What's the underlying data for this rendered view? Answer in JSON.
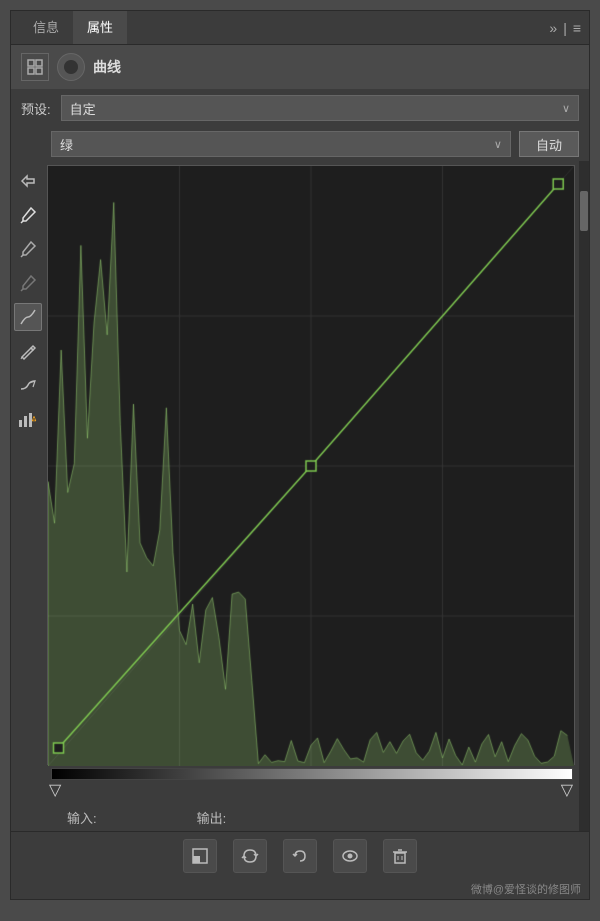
{
  "tabs": [
    {
      "label": "信息",
      "active": false
    },
    {
      "label": "属性",
      "active": true
    }
  ],
  "tab_icons": {
    "double_arrow": "»",
    "divider": "|",
    "menu": "≡"
  },
  "panel_title": "曲线",
  "preset": {
    "label": "预设:",
    "value": "自定",
    "arrow": "∨"
  },
  "channel": {
    "value": "绿",
    "arrow": "∨"
  },
  "auto_btn": "自动",
  "tools": [
    {
      "name": "eyedropper-white",
      "icon": "⁍"
    },
    {
      "name": "eyedropper-gray",
      "icon": "⁌"
    },
    {
      "name": "eyedropper-black",
      "icon": "⁍"
    },
    {
      "name": "curve-tool",
      "icon": "∿",
      "active": true
    },
    {
      "name": "pencil-tool",
      "icon": "✏"
    },
    {
      "name": "arrow-back",
      "icon": "↩"
    },
    {
      "name": "histogram-warning",
      "icon": "▦"
    }
  ],
  "io": {
    "input_label": "输入:",
    "output_label": "输出:",
    "input_value": "",
    "output_value": ""
  },
  "bottom_tools": [
    {
      "name": "clip-below",
      "icon": "⊡"
    },
    {
      "name": "eye-cycle",
      "icon": "↺"
    },
    {
      "name": "reset",
      "icon": "↩"
    },
    {
      "name": "visibility",
      "icon": "◉"
    },
    {
      "name": "delete",
      "icon": "🗑"
    }
  ],
  "watermark": "微博@爱怪谈的修图师",
  "accent_color": "#7ec850",
  "curve_points": [
    {
      "x": 0.02,
      "y": 0.98
    },
    {
      "x": 0.5,
      "y": 0.5
    },
    {
      "x": 0.98,
      "y": 0.02
    }
  ]
}
